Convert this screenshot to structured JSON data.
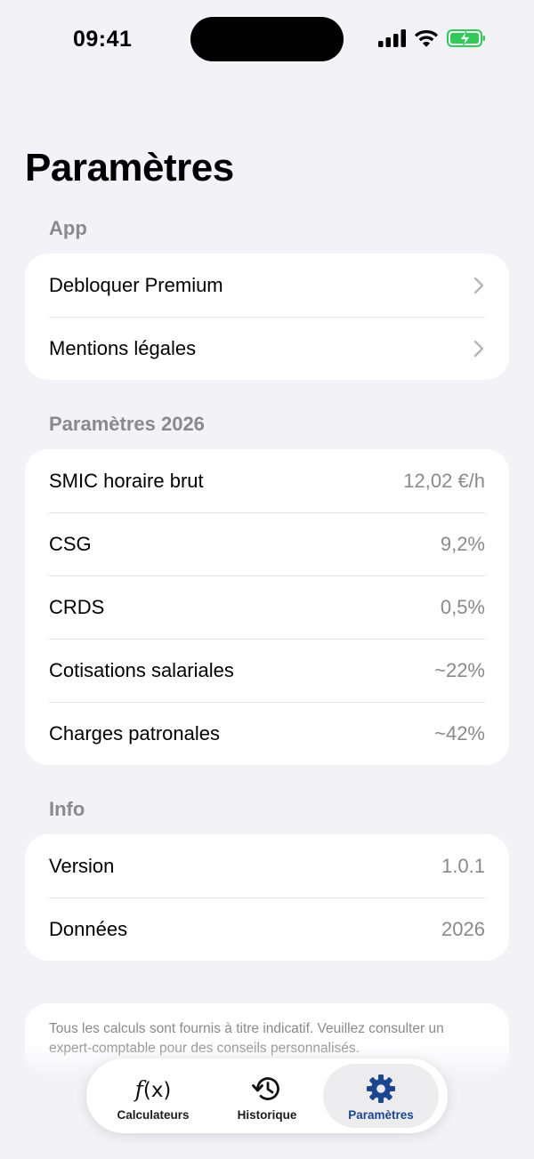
{
  "status_bar": {
    "time": "09:41"
  },
  "title": "Paramètres",
  "sections": {
    "app": {
      "header": "App",
      "items": [
        {
          "label": "Debloquer Premium"
        },
        {
          "label": "Mentions légales"
        }
      ]
    },
    "params": {
      "header": "Paramètres 2026",
      "items": [
        {
          "label": "SMIC horaire brut",
          "value": "12,02 €/h"
        },
        {
          "label": "CSG",
          "value": "9,2%"
        },
        {
          "label": "CRDS",
          "value": "0,5%"
        },
        {
          "label": "Cotisations salariales",
          "value": "~22%"
        },
        {
          "label": "Charges patronales",
          "value": "~42%"
        }
      ]
    },
    "info": {
      "header": "Info",
      "items": [
        {
          "label": "Version",
          "value": "1.0.1"
        },
        {
          "label": "Données",
          "value": "2026"
        }
      ]
    }
  },
  "disclaimer": "Tous les calculs sont fournis à titre indicatif. Veuillez consulter un expert-comptable pour des conseils personnalisés.",
  "tab_bar": {
    "tabs": [
      {
        "label": "Calculateurs",
        "icon": "function-icon"
      },
      {
        "label": "Historique",
        "icon": "history-icon"
      },
      {
        "label": "Paramètres",
        "icon": "gear-icon",
        "active": true
      }
    ],
    "fx_glyph": "f",
    "fx_paren": "(x)"
  },
  "colors": {
    "background": "#f2f2f7",
    "accent": "#1a4590",
    "secondary_text": "#8a8a8e",
    "battery": "#34c759"
  }
}
